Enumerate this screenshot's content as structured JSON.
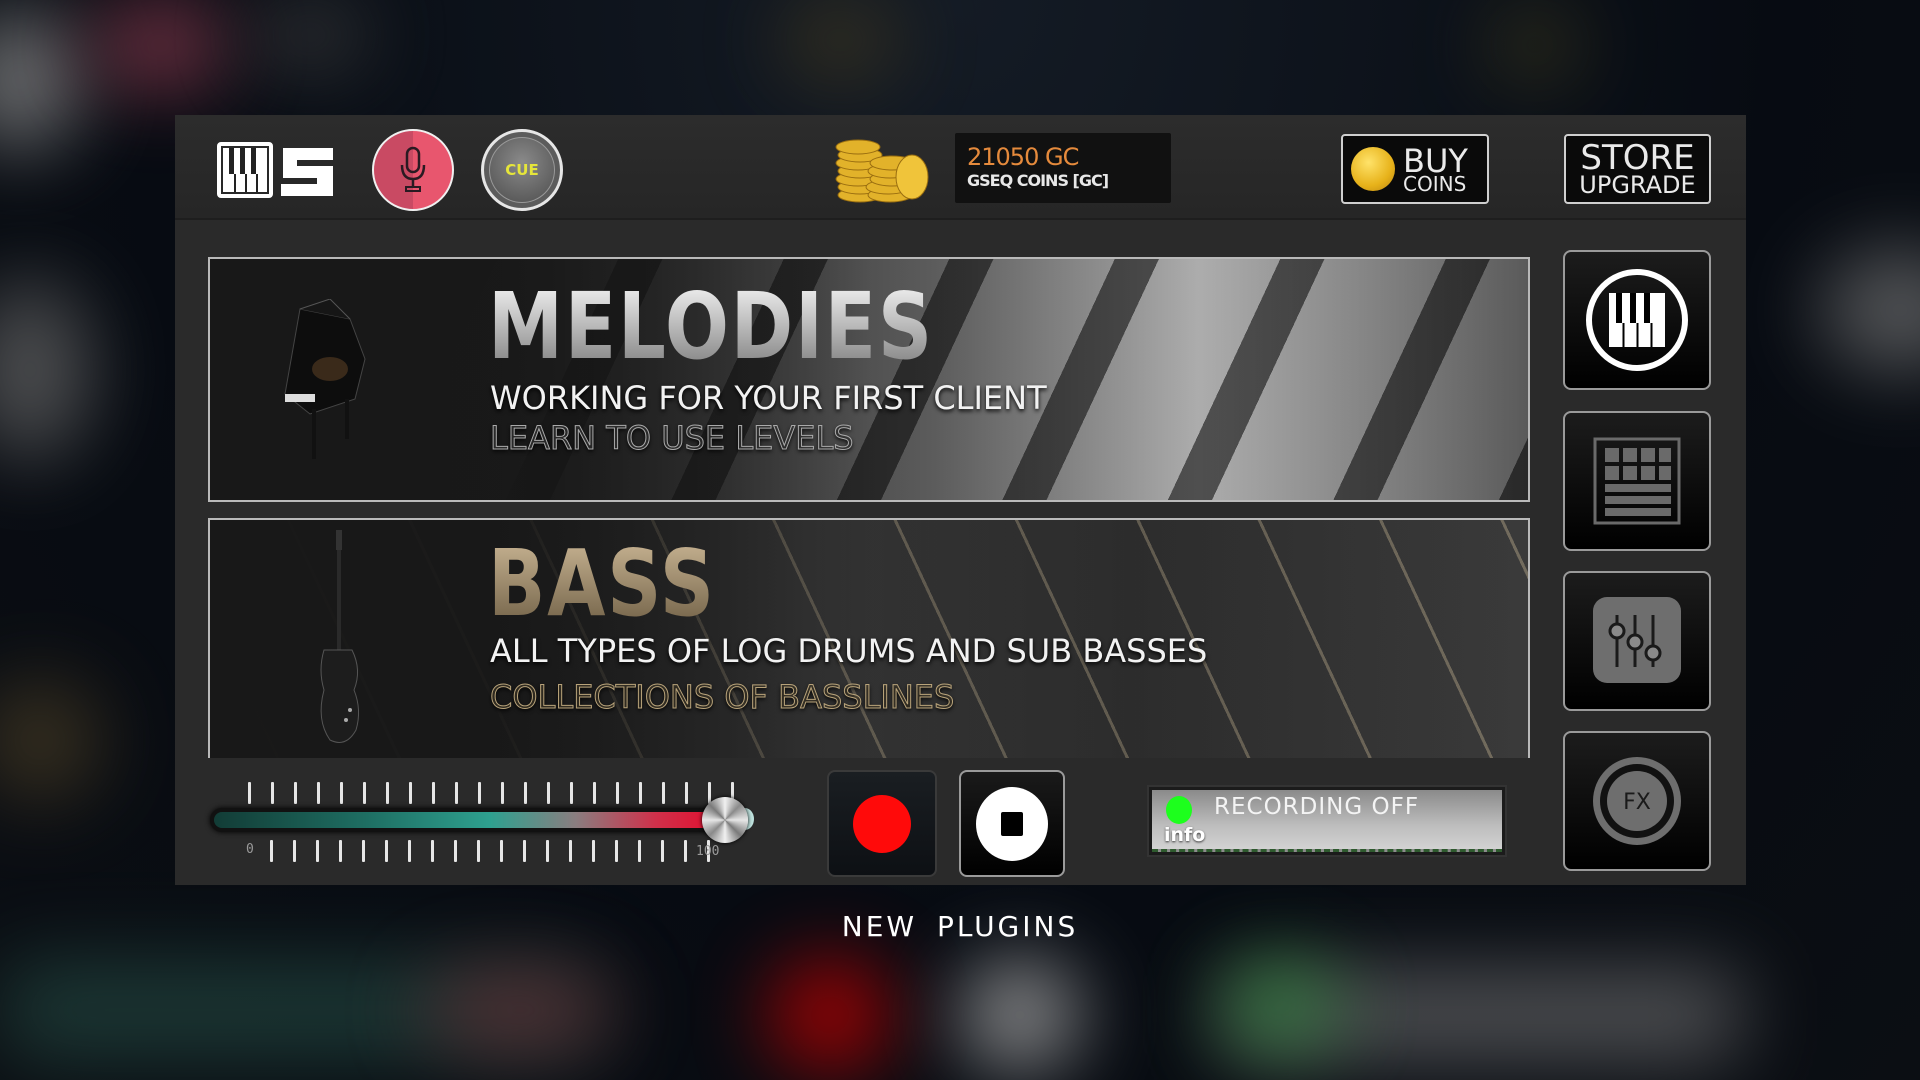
{
  "app": {
    "logo_name": "piano-5-logo"
  },
  "topbar": {
    "mic_button": {
      "icon": "microphone-icon"
    },
    "cue_button": {
      "label": "CUE"
    },
    "coins": {
      "icon": "coin-stack-icon",
      "amount": "21050 GC",
      "label": "GSEQ COINS [GC]"
    },
    "buy_coins": {
      "label_top": "BUY",
      "label_bottom": "COINS",
      "icon": "gold-coin-icon"
    },
    "store": {
      "label_top": "STORE",
      "label_bottom": "UPGRADE"
    }
  },
  "banners": [
    {
      "id": "melodies",
      "title": "MELODIES",
      "line1": "WORKING FOR YOUR FIRST CLIENT",
      "line2": "LEARN TO USE LEVELS",
      "icon": "grand-piano-icon"
    },
    {
      "id": "bass",
      "title": "BASS",
      "line1": "ALL TYPES OF LOG DRUMS AND SUB BASSES",
      "line2": "COLLECTIONS OF BASSLINES",
      "icon": "electric-guitar-icon"
    }
  ],
  "sidebar": [
    {
      "name": "piano-keys-button",
      "icon": "piano-keys-icon"
    },
    {
      "name": "drum-pad-button",
      "icon": "drum-pad-icon"
    },
    {
      "name": "mixer-button",
      "icon": "mixer-sliders-icon"
    },
    {
      "name": "fx-button",
      "icon": "fx-icon",
      "label": "FX"
    }
  ],
  "controls": {
    "volume": {
      "min_label": "0",
      "max_label": "100",
      "value": 100,
      "min": 0,
      "max": 100
    },
    "record_button": {
      "icon": "record-icon",
      "color": "#ff0a0a"
    },
    "stop_button": {
      "icon": "stop-icon"
    },
    "status": {
      "led_color": "#1dff1d",
      "text": "RECORDING OFF",
      "info": "info"
    }
  },
  "footer": {
    "label": "NEW PLUGINS"
  }
}
